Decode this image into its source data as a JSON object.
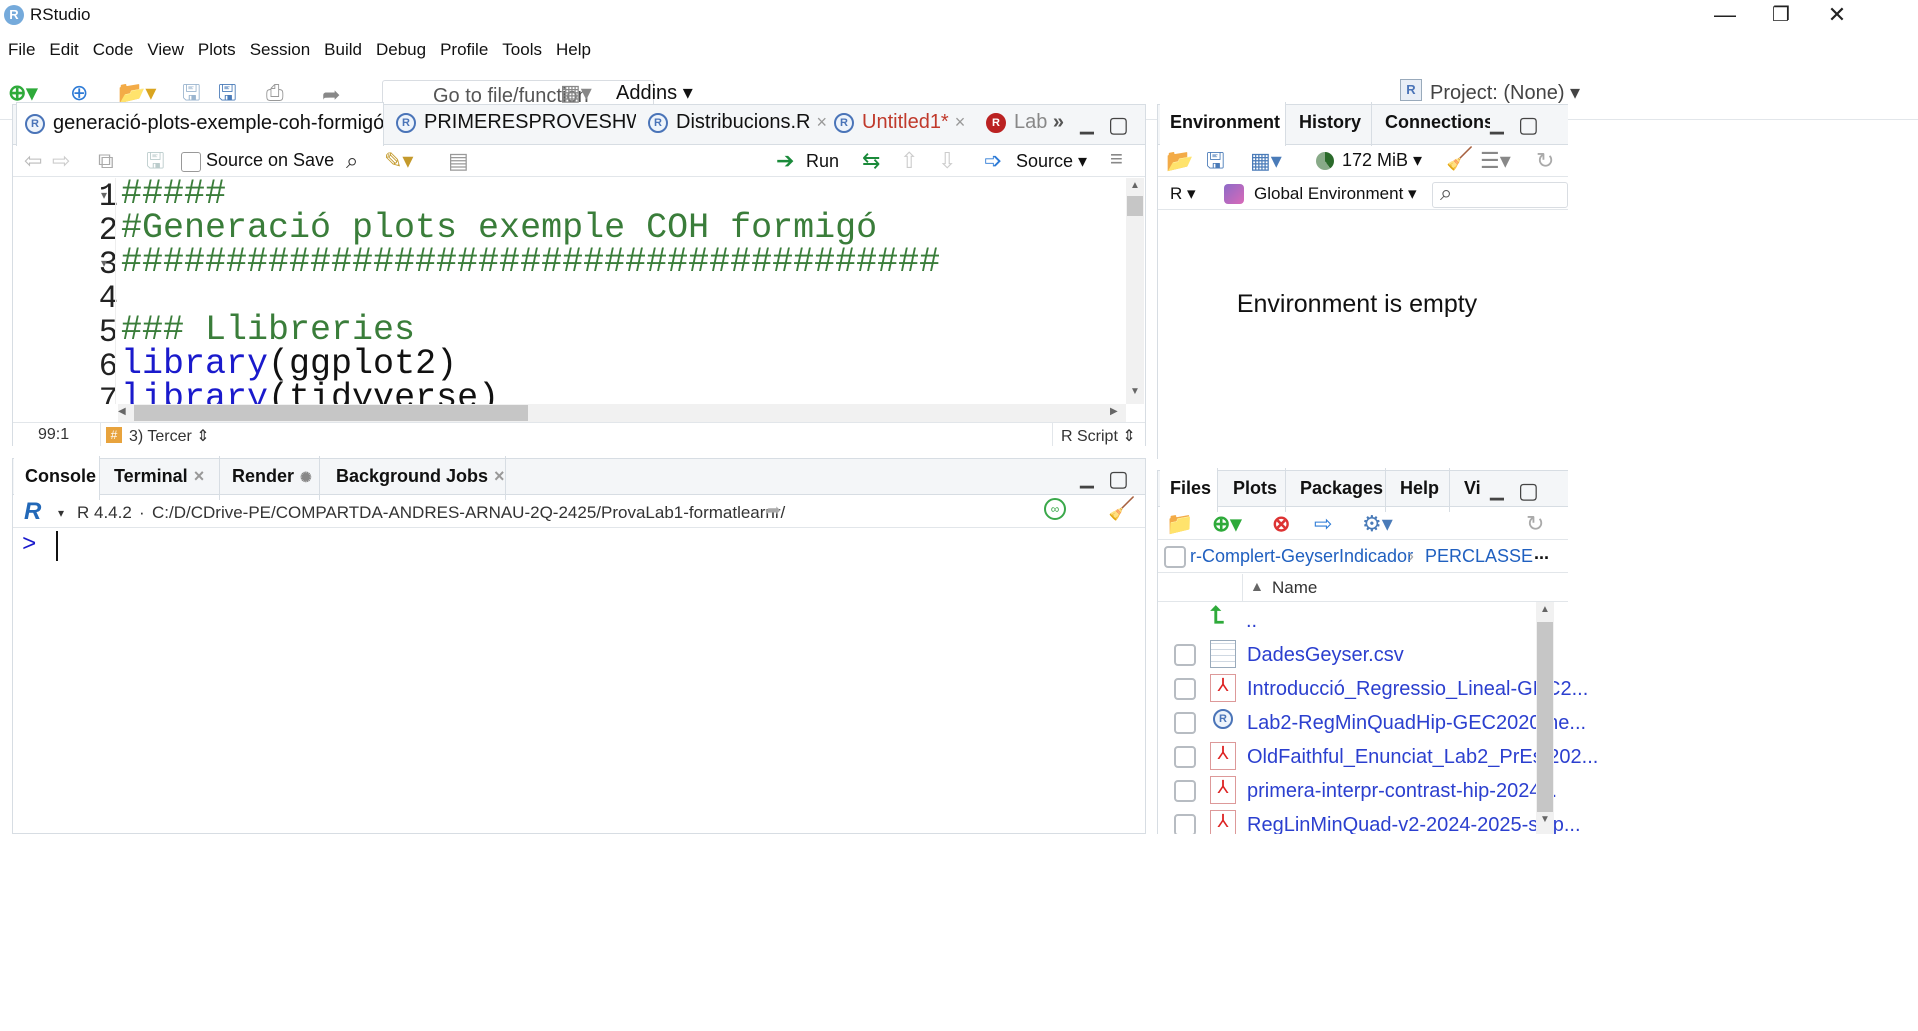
{
  "window": {
    "title": "RStudio",
    "app_icon": "R",
    "minimize": "—",
    "restore": "❐",
    "close": "✕"
  },
  "menu": [
    "File",
    "Edit",
    "Code",
    "View",
    "Plots",
    "Session",
    "Build",
    "Debug",
    "Profile",
    "Tools",
    "Help"
  ],
  "toolbar": {
    "goto_placeholder": "Go to file/function",
    "addins": "Addins",
    "project": "Project: (None)"
  },
  "editor": {
    "tabs": [
      {
        "label": "generació-plots-exemple-coh-formigó.R",
        "active": true
      },
      {
        "label": "PRIMERESPROVESHW.R",
        "active": false
      },
      {
        "label": "Distribucions.R",
        "active": false
      },
      {
        "label": "Untitled1*",
        "active": false,
        "unsaved": true
      },
      {
        "label": "Lab",
        "active": false
      }
    ],
    "source_on_save": "Source on Save",
    "run": "Run",
    "source": "Source",
    "lines": [
      {
        "n": "1",
        "text": "#####"
      },
      {
        "n": "2",
        "text": "#Generació plots exemple COH formigó"
      },
      {
        "n": "3",
        "text": "#######################################"
      },
      {
        "n": "4",
        "text": ""
      },
      {
        "n": "5",
        "text": "### Llibreries"
      },
      {
        "n": "6",
        "fn": "library",
        "arg": "ggplot2"
      },
      {
        "n": "7",
        "fn": "library",
        "arg": "tidyverse"
      }
    ],
    "status_pos": "99:1",
    "status_section": "3) Tercer",
    "status_type": "R Script"
  },
  "console": {
    "tabs": [
      "Console",
      "Terminal",
      "Render",
      "Background Jobs"
    ],
    "version": "R 4.4.2",
    "path": "C:/D/CDrive-PE/COMPARTDA-ANDRES-ARNAU-2Q-2425/ProvaLab1-formatlearnr/",
    "prompt": ">"
  },
  "environment": {
    "tabs": [
      "Environment",
      "History",
      "Connections"
    ],
    "memory": "172 MiB",
    "lang": "R",
    "scope": "Global Environment",
    "empty_msg": "Environment is empty"
  },
  "files": {
    "tabs": [
      "Files",
      "Plots",
      "Packages",
      "Help",
      "Vi"
    ],
    "breadcrumb": [
      "r-Complert-GeyserIndicador",
      "PERCLASSE"
    ],
    "more": "...",
    "header_name": "Name",
    "up": "..",
    "items": [
      {
        "name": "DadesGeyser.csv",
        "icon": "table-icon"
      },
      {
        "name": "Introducció_Regressio_Lineal-GEC2...",
        "icon": "pdf-icon"
      },
      {
        "name": "Lab2-RegMinQuadHip-GEC2020-ne...",
        "icon": "r-file-icon"
      },
      {
        "name": "OldFaithful_Enunciat_Lab2_PrEst202...",
        "icon": "pdf-icon"
      },
      {
        "name": "primera-interpr-contrast-hip-2024...",
        "icon": "pdf-icon"
      },
      {
        "name": "RegLinMinQuad-v2-2024-2025-sli.p...",
        "icon": "pdf-icon"
      }
    ]
  },
  "colors": {
    "accent": "#75aadb",
    "comment": "#3a7d3a",
    "keyword": "#1a1acc",
    "link": "#2b3fcf"
  }
}
